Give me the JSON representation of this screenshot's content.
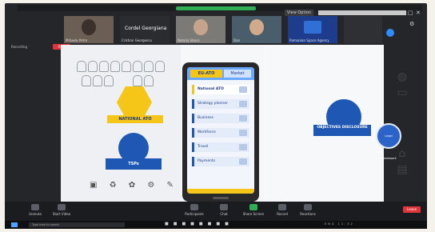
{
  "window": {
    "title": "Zoom Meeting",
    "view_option": "View Option",
    "title_right": "",
    "controls": [
      "–",
      "□",
      "✕"
    ]
  },
  "gallery": [
    {
      "name": "Mihaela Petre",
      "caption": ""
    },
    {
      "name": "Cristian Georgescu",
      "caption": "Cordel Georgiana"
    },
    {
      "name": "Natalia Stoica",
      "caption": ""
    },
    {
      "name": "Dan",
      "caption": ""
    },
    {
      "name": "Romanian Space Agency",
      "caption": ""
    },
    {
      "name": "",
      "caption": ""
    }
  ],
  "status": {
    "text": "Recording",
    "rec_badge": "REC"
  },
  "presentation": {
    "left_label": "NATIONAL ATO",
    "circle_label": "TSPs",
    "phone_tabs": [
      "EU-ATO",
      "Market"
    ],
    "phone_rows": [
      {
        "label": "National ATO"
      },
      {
        "label": "Strategy planner"
      },
      {
        "label": "Business"
      },
      {
        "label": "Workforce"
      },
      {
        "label": "Travel"
      },
      {
        "label": "Payments"
      }
    ],
    "objectives_label": "OBJECTIVES DISCLOSURE",
    "small_circle_label": "Legal Framework"
  },
  "toolbar": {
    "buttons": [
      {
        "label": "Unmute",
        "icon": "microphone-icon"
      },
      {
        "label": "Start Video",
        "icon": "video-icon"
      },
      {
        "label": "Participants",
        "icon": "participants-icon"
      },
      {
        "label": "Chat",
        "icon": "chat-icon"
      },
      {
        "label": "Share Screen",
        "icon": "share-icon"
      },
      {
        "label": "Record",
        "icon": "record-icon"
      },
      {
        "label": "Reactions",
        "icon": "reactions-icon"
      }
    ],
    "leave": "Leave"
  },
  "taskbar": {
    "search_placeholder": "Type here to search",
    "tray_text": "ENG 11:32"
  },
  "colors": {
    "accent": "#2d8cff",
    "danger": "#e0353b",
    "brand_blue": "#1f58b4",
    "brand_yellow": "#f5c518"
  }
}
